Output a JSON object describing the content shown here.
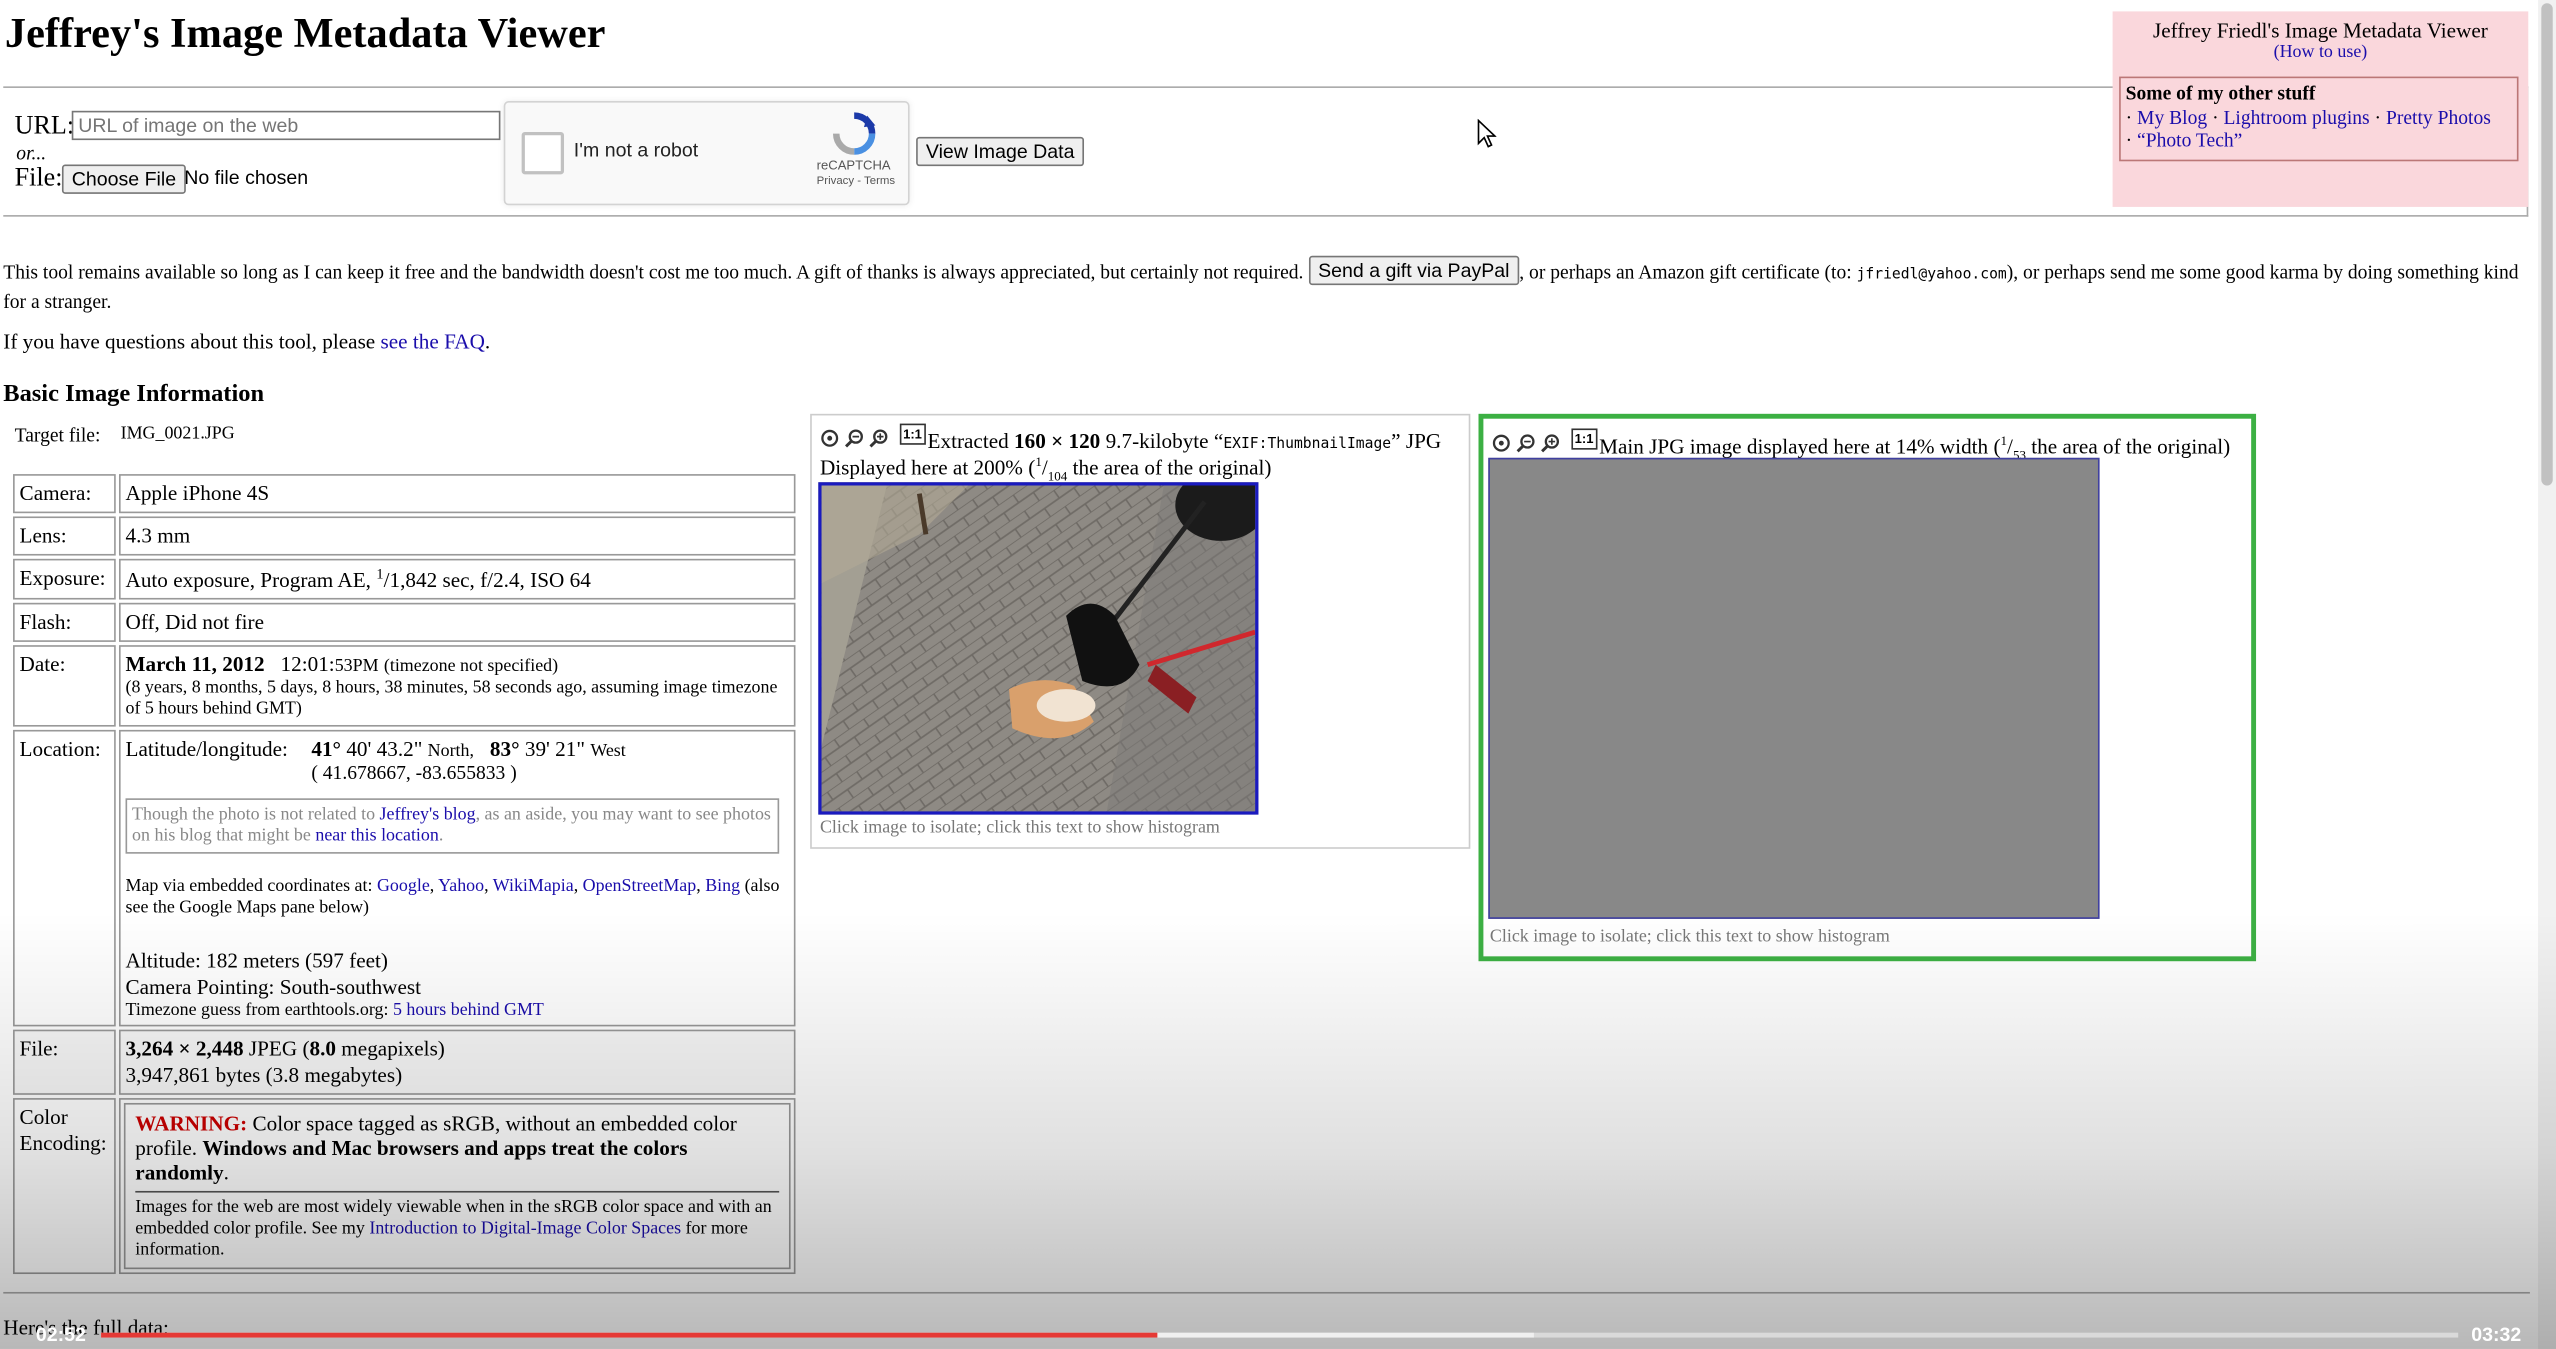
{
  "page_title": "Jeffrey's Image Metadata Viewer",
  "form": {
    "url_label": "URL:",
    "url_placeholder": "URL of image on the web",
    "or_label": "or...",
    "file_label": "File:",
    "choose_file_button": "Choose File",
    "no_file_text": "No file chosen",
    "captcha_label": "I'm not a robot",
    "captcha_brand": "reCAPTCHA",
    "captcha_privacy": "Privacy",
    "captcha_terms": "Terms",
    "captcha_separator": " - ",
    "view_button": "View Image Data"
  },
  "side_panel": {
    "title": "Jeffrey Friedl's Image Metadata Viewer",
    "how_to_use": "(How to use)",
    "other_stuff_heading": "Some of my other stuff",
    "links": [
      "My Blog",
      "Lightroom plugins",
      "Pretty Photos",
      "“Photo Tech”"
    ],
    "separator": "·"
  },
  "intro": {
    "text_before": "This tool remains available so long as I can keep it free and the bandwidth doesn't cost me too much. A gift of thanks is always appreciated, but certainly not required.",
    "paypal_button": "Send a gift via PayPal",
    "text_middle": ", or perhaps an Amazon gift certificate (to: ",
    "email": "jfriedl@yahoo.com",
    "text_after": "), or perhaps send me some good karma by doing something kind for a stranger.",
    "faq_prefix": "If you have questions about this tool, please ",
    "faq_link": "see the FAQ",
    "faq_suffix": "."
  },
  "basic_info": {
    "heading": "Basic Image Information",
    "target_label": "Target file:",
    "target_value": "IMG_0021.JPG",
    "camera_label": "Camera:",
    "camera_value": "Apple iPhone 4S",
    "lens_label": "Lens:",
    "lens_value": "4.3 mm",
    "exposure_label": "Exposure:",
    "exposure_prefix": "Auto exposure, Program AE, ",
    "exposure_num": "1",
    "exposure_den": "1,842",
    "exposure_suffix": " sec, f/2.4, ISO 64",
    "flash_label": "Flash:",
    "flash_value": "Off, Did not fire",
    "date_label": "Date:",
    "date_value": "March 11, 2012",
    "time_main": "12:01:",
    "time_small": "53PM",
    "tz_note": "(timezone not specified)",
    "date_ago": "(8 years, 8 months, 5 days, 8 hours, 38 minutes, 58 seconds ago, assuming image timezone of 5 hours behind GMT)",
    "location_label": "Location:",
    "latlong_label": "Latitude/longitude:",
    "lat_deg": "41°",
    "lat_rest": " 40' 43.2\"",
    "lat_dir": "North,",
    "lon_deg": "83°",
    "lon_rest": " 39' 21\"",
    "lon_dir": "West",
    "decimal_coords": "( 41.678667, -83.655833 )",
    "blog_note_prefix": "Though the photo is not related to ",
    "blog_link": "Jeffrey's blog",
    "blog_note_middle": ", as an aside, you may want to see photos on his blog that might be ",
    "near_link": "near this location",
    "blog_note_suffix": ".",
    "map_prefix": "Map via embedded coordinates at: ",
    "map_links": [
      "Google",
      "Yahoo",
      "WikiMapia",
      "OpenStreetMap",
      "Bing"
    ],
    "map_suffix": " (also see the Google Maps pane below)",
    "altitude": "Altitude: 182 meters (597 feet)",
    "camera_pointing": "Camera Pointing: South-southwest",
    "tz_guess_prefix": "Timezone guess from earthtools.org: ",
    "tz_guess_link": "5 hours behind GMT",
    "file_label": "File:",
    "file_dims": "3,264 × 2,448",
    "file_type": " JPEG (",
    "file_mp": "8.0",
    "file_mp_suffix": " megapixels)",
    "file_bytes": "3,947,861 bytes (3.8 megabytes)",
    "color_label": "Color Encoding:",
    "warning_word": "WARNING:",
    "warning_text": " Color space tagged as sRGB, without an embedded color profile. ",
    "warning_bold": "Windows and Mac browsers and apps treat the colors randomly",
    "warning_end": ".",
    "color_note_prefix": "Images for the web are most widely viewable when in the sRGB color space and with an embedded color profile. See my ",
    "color_note_link": "Introduction to Digital-Image Color Spaces",
    "color_note_suffix": " for more information."
  },
  "thumb_pane": {
    "extracted": "Extracted ",
    "dims": "160 × 120",
    "size_text": " 9.7-kilobyte “",
    "tag": "EXIF:ThumbnailImage",
    "after_tag": "” JPG",
    "displayed_prefix": "Displayed here at 200% (",
    "frac_num": "1",
    "frac_den": "104",
    "displayed_suffix": " the area of the original)",
    "caption": "Click image to isolate; click this text to show histogram",
    "one_to_one": "1:1"
  },
  "main_pane": {
    "text_prefix": "Main JPG image displayed here at 14% width (",
    "frac_num": "1",
    "frac_den": "53",
    "text_suffix": " the area of the original)",
    "caption": "Click image to isolate; click this text to show histogram",
    "one_to_one": "1:1",
    "border_color": "#3cb043"
  },
  "full_data_text": "Here's the full data:",
  "video": {
    "elapsed": "02:52",
    "duration": "03:32",
    "progress_fraction": 0.448,
    "buffer_fraction": 0.608,
    "progress_color": "#e53935"
  }
}
